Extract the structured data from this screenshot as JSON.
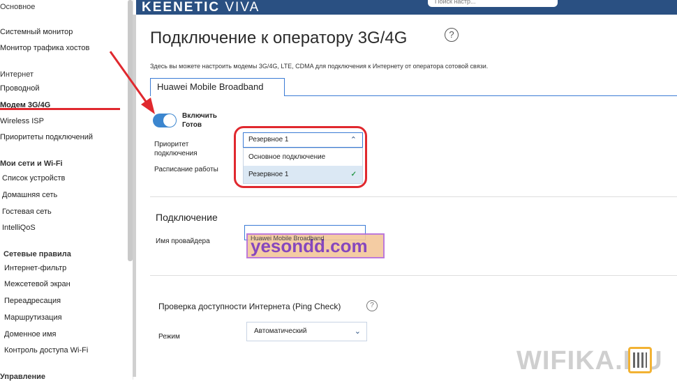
{
  "brand": {
    "name": "KEENETIC",
    "model": "VIVA"
  },
  "search": {
    "placeholder": "Поиск настр..."
  },
  "sidebar": {
    "sections": [
      {
        "title": "Основное",
        "items": [
          "Системный монитор",
          "Монитор трафика хостов"
        ]
      },
      {
        "title": "Интернет",
        "items": [
          "Проводной",
          "Модем 3G/4G",
          "Wireless ISP",
          "Приоритеты подключений"
        ]
      },
      {
        "title": "Мои сети и Wi-Fi",
        "items": [
          "Список устройств",
          "Домашняя сеть",
          "Гостевая сеть",
          "IntelliQoS"
        ]
      },
      {
        "title": "Сетевые правила",
        "items": [
          "Интернет-фильтр",
          "Межсетевой экран",
          "Переадресация",
          "Маршрутизация",
          "Доменное имя",
          "Контроль доступа Wi-Fi"
        ]
      },
      {
        "title": "Управление",
        "items": []
      }
    ],
    "active": "Модем 3G/4G"
  },
  "page": {
    "title": "Подключение к оператору 3G/4G",
    "description": "Здесь вы можете настроить модемы 3G/4G, LTE, CDMA для подключения к Интернету от оператора сотовой связи.",
    "tab": "Huawei Mobile Broadband",
    "toggle": {
      "label": "Включить",
      "status": "Готов",
      "on": true
    },
    "priority": {
      "label": "Приоритет подключения",
      "selected": "Резервное 1",
      "options": [
        "Основное подключение",
        "Резервное 1"
      ]
    },
    "schedule_label": "Расписание работы",
    "connection": {
      "title": "Подключение",
      "provider_label": "Имя провайдера",
      "provider_value": "Huawei Mobile Broadband"
    },
    "ping": {
      "title": "Проверка доступности Интернета (Ping Check)",
      "mode_label": "Режим",
      "mode_value": "Автоматический"
    }
  },
  "watermark_text": "yesondd.com",
  "site_logo_text": "WIFIKA.RU",
  "colors": {
    "header": "#2a5082",
    "accent": "#3a7bd5",
    "highlight": "#e0282e"
  }
}
